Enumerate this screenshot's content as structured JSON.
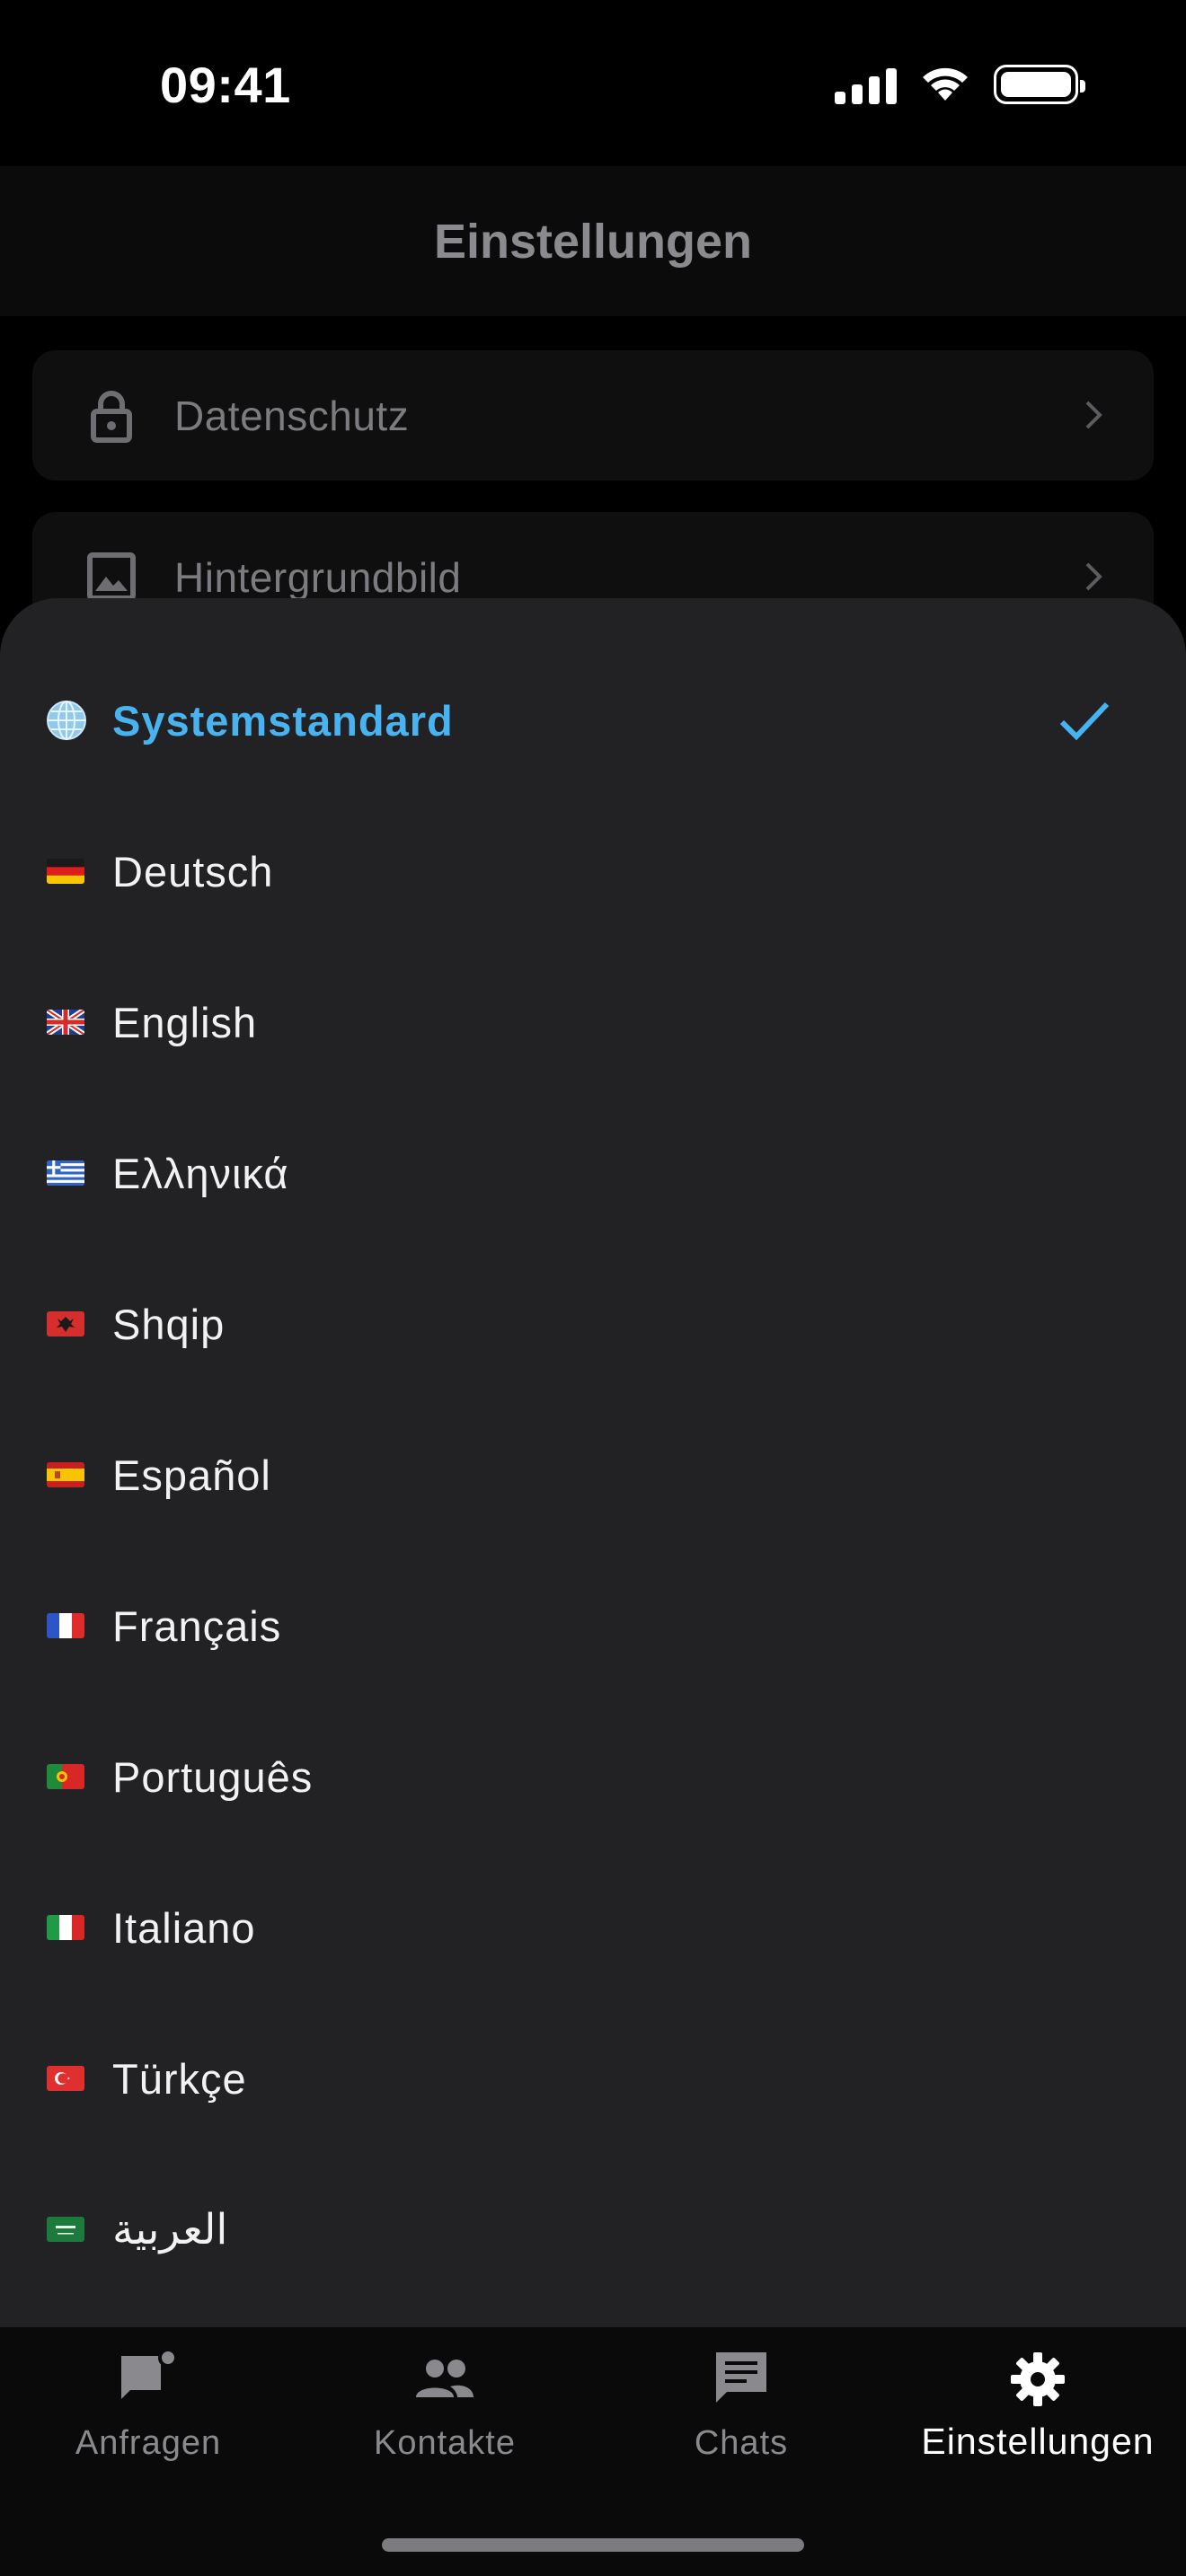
{
  "status_bar": {
    "time": "09:41"
  },
  "header": {
    "title": "Einstellungen"
  },
  "background_cards": [
    {
      "label": "Datenschutz",
      "icon": "lock-icon"
    },
    {
      "label": "Hintergrundbild",
      "icon": "image-icon"
    }
  ],
  "language_sheet": {
    "selected_index": 0,
    "accent_color": "#47b3f0",
    "items": [
      {
        "label": "Systemstandard",
        "icon": "globe-icon"
      },
      {
        "label": "Deutsch",
        "icon": "flag-de-icon"
      },
      {
        "label": "English",
        "icon": "flag-gb-icon"
      },
      {
        "label": "Ελληνικά",
        "icon": "flag-gr-icon"
      },
      {
        "label": "Shqip",
        "icon": "flag-al-icon"
      },
      {
        "label": "Español",
        "icon": "flag-es-icon"
      },
      {
        "label": "Français",
        "icon": "flag-fr-icon"
      },
      {
        "label": "Português",
        "icon": "flag-pt-icon"
      },
      {
        "label": "Italiano",
        "icon": "flag-it-icon"
      },
      {
        "label": "Türkçe",
        "icon": "flag-tr-icon"
      },
      {
        "label": "العربية",
        "icon": "flag-sa-icon"
      }
    ]
  },
  "tab_bar": {
    "active_index": 3,
    "tabs": [
      {
        "label": "Anfragen",
        "icon": "request-icon"
      },
      {
        "label": "Kontakte",
        "icon": "contacts-icon"
      },
      {
        "label": "Chats",
        "icon": "chat-icon"
      },
      {
        "label": "Einstellungen",
        "icon": "gear-icon"
      }
    ]
  }
}
